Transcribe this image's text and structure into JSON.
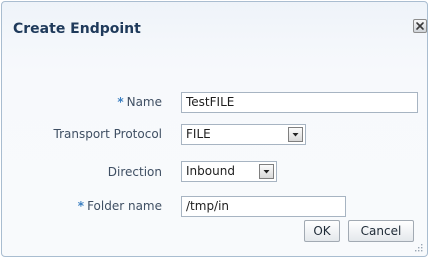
{
  "dialog": {
    "title": "Create Endpoint"
  },
  "form": {
    "name": {
      "required": "*",
      "label": "Name",
      "value": "TestFILE"
    },
    "transport_protocol": {
      "label": "Transport Protocol",
      "value": "FILE"
    },
    "direction": {
      "label": "Direction",
      "value": "Inbound"
    },
    "folder_name": {
      "required": "*",
      "label": "Folder name",
      "value": "/tmp/in"
    }
  },
  "buttons": {
    "ok": "OK",
    "cancel": "Cancel"
  },
  "icons": {
    "close": "close-icon",
    "dropdown": "chevron-down-icon",
    "resize": "resize-grip-icon"
  }
}
